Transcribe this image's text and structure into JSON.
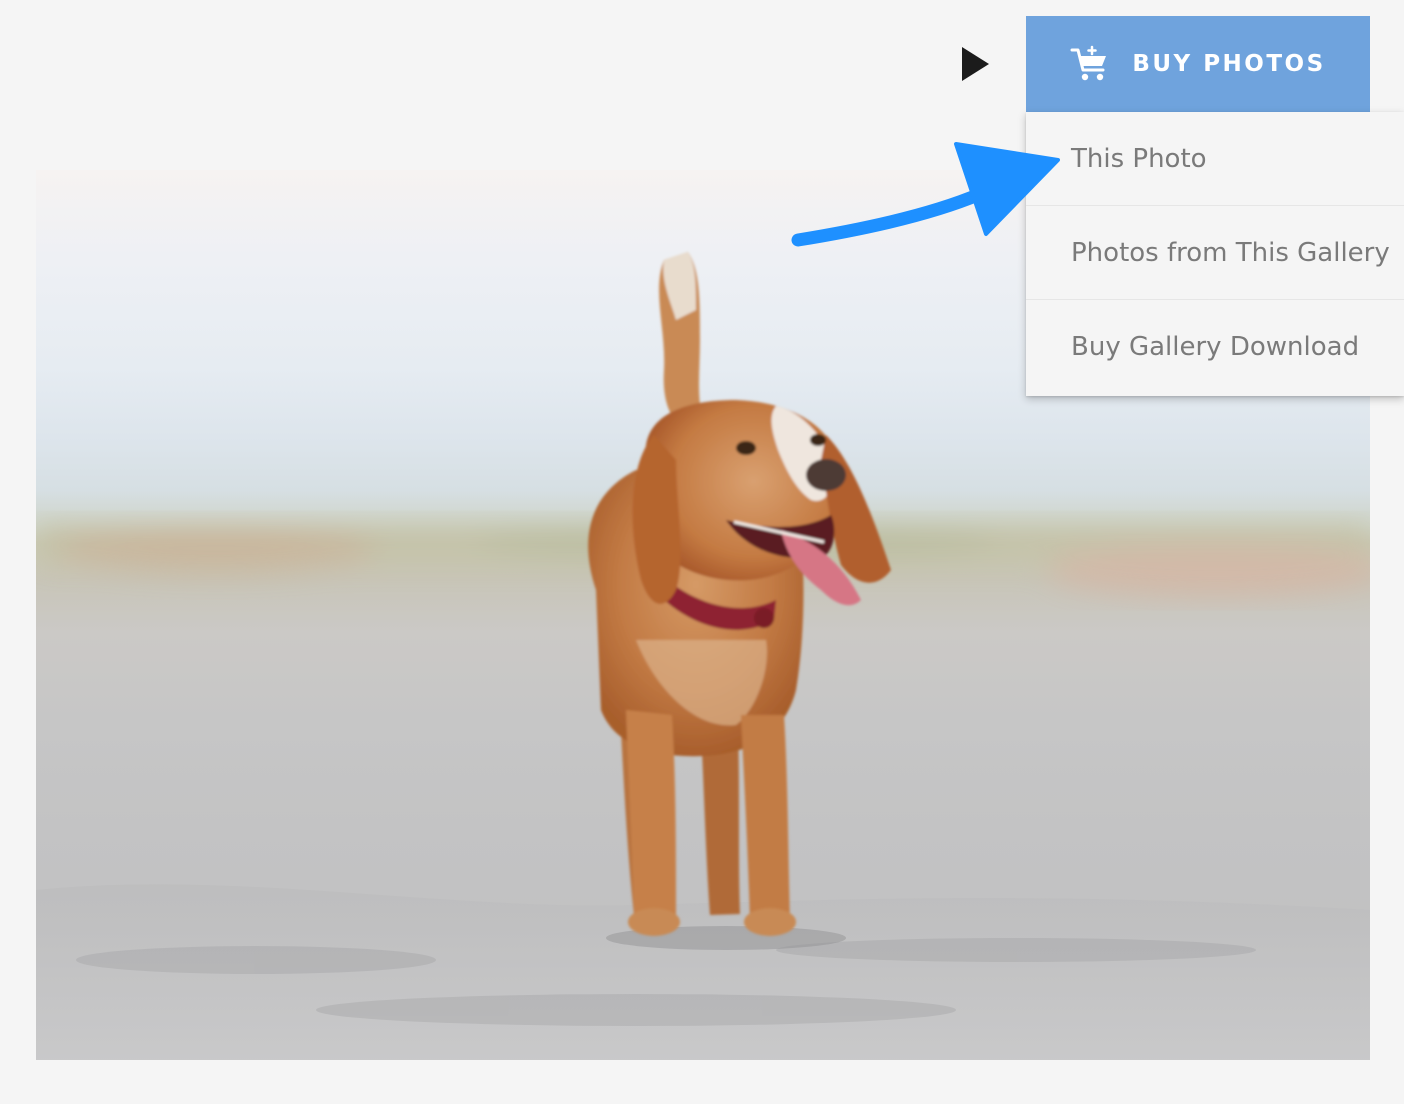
{
  "buy_button": {
    "label": "BUY PHOTOS",
    "icon": "cart-icon",
    "color": "#6fa3dd"
  },
  "dropdown": {
    "items": [
      {
        "label": "This Photo"
      },
      {
        "label": "Photos from This Gallery"
      },
      {
        "label": "Buy Gallery Download"
      }
    ]
  },
  "play_icon": "play-icon",
  "annotation": {
    "icon": "arrow-pointer-icon",
    "color": "#1e90ff"
  },
  "photo": {
    "subject": "dog-on-beach-photo"
  }
}
